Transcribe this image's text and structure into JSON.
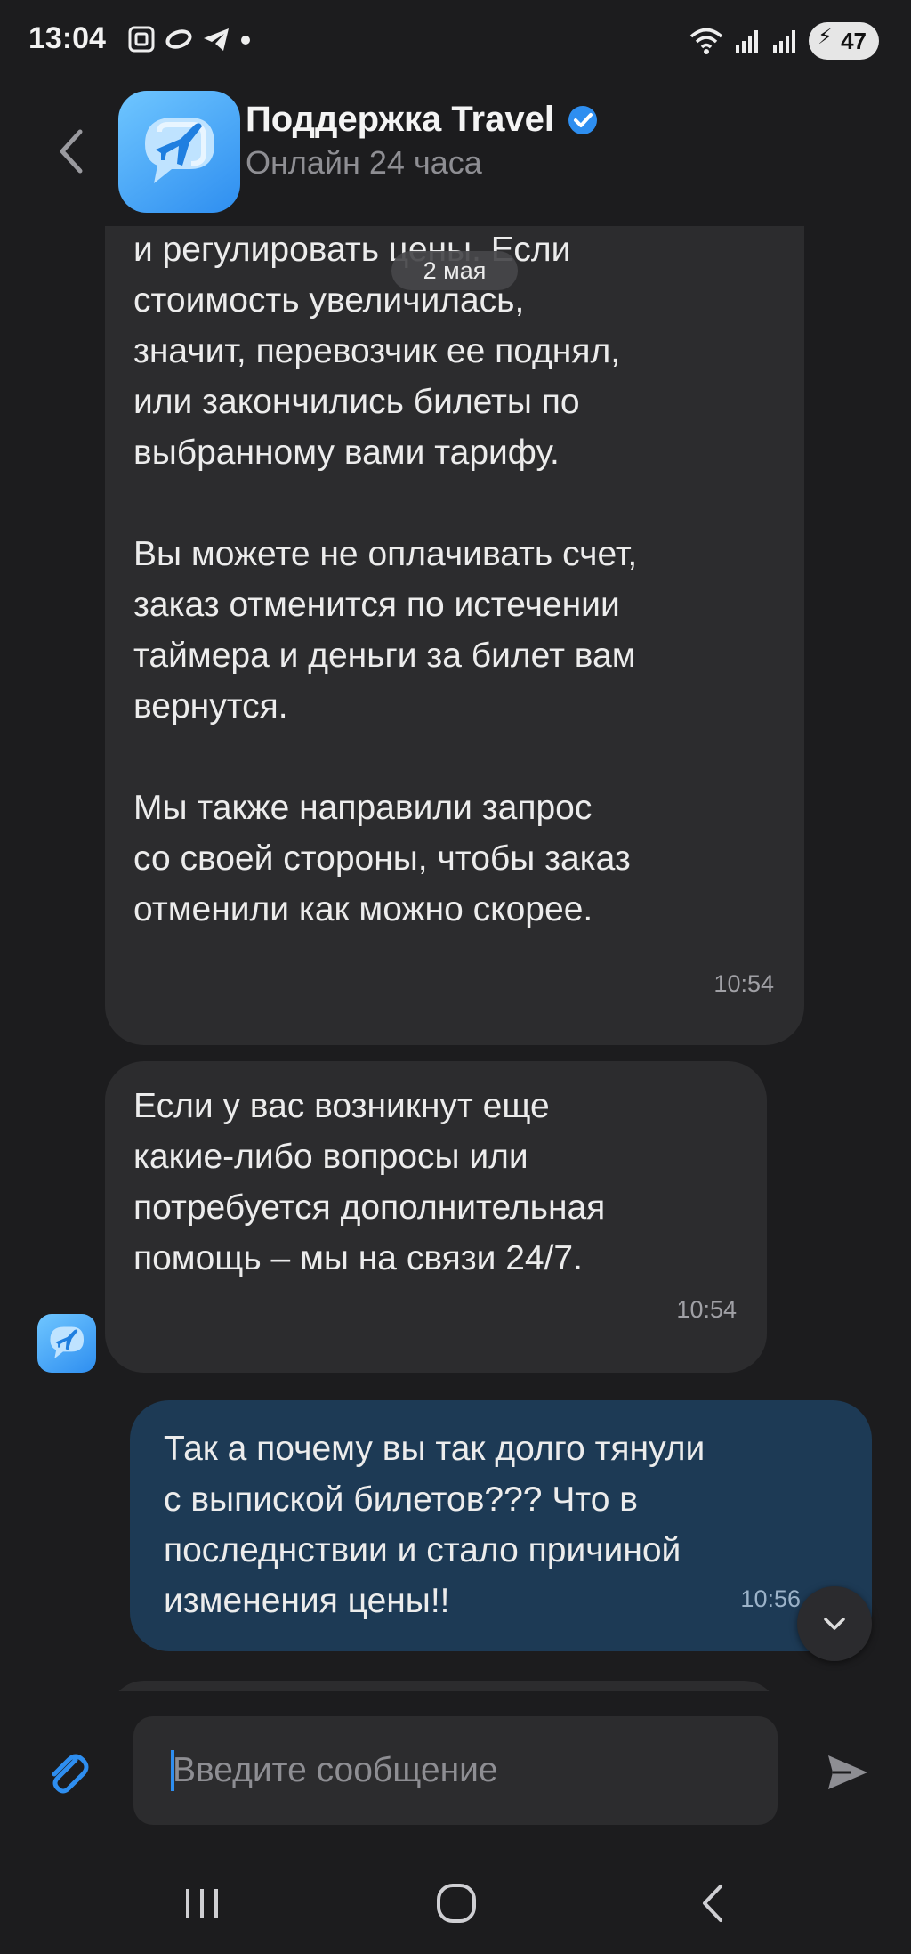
{
  "status_bar": {
    "time": "13:04",
    "battery": "47",
    "left_icons": [
      "screenshot-icon",
      "link-icon",
      "telegram-icon",
      "dot-icon"
    ],
    "right_icons": [
      "wifi-icon",
      "signal-icon",
      "signal-icon",
      "battery-icon"
    ]
  },
  "header": {
    "title": "Поддержка Travel",
    "subtitle": "Онлайн 24 часа",
    "verified_color": "#2e8ef0"
  },
  "date_chip": "2 мая",
  "messages": [
    {
      "direction": "incoming",
      "text": "и регулировать цены. Если\nстоимость увеличилась,\nзначит, перевозчик ее поднял,\nили закончились билеты по\nвыбранному вами тарифу.\n\nВы можете не оплачивать счет,\nзаказ отменится по истечении\nтаймера и деньги за билет вам\nвернутся.\n\nМы также направили запрос\nсо своей стороны, чтобы заказ\nотменили как можно скорее.",
      "time": "10:54"
    },
    {
      "direction": "incoming",
      "text": "Если у вас возникнут еще\nкакие-либо вопросы или\nпотребуется дополнительная\nпомощь – мы на связи 24/7.",
      "time": "10:54"
    },
    {
      "direction": "outgoing",
      "text": "Так а почему вы так долго тянули\nс выпиской билетов??? Что в\nпоследнствии и стало причиной\nизменения цены!!",
      "time": "10:56"
    }
  ],
  "composer": {
    "placeholder": "Введите сообщение"
  },
  "colors": {
    "background": "#1c1c1e",
    "incoming_bubble": "#2c2c2e",
    "outgoing_bubble": "#1d3a55",
    "accent": "#2e8ef0"
  }
}
